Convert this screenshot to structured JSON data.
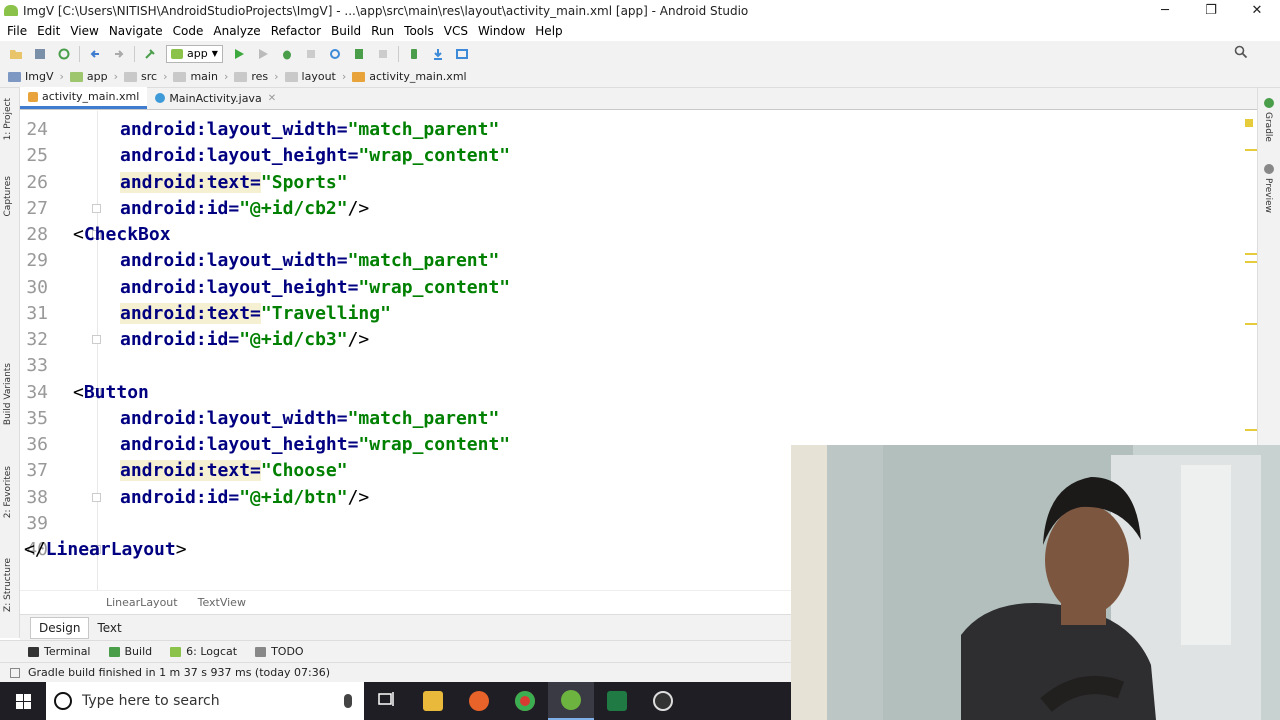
{
  "window": {
    "title": "ImgV [C:\\Users\\NITISH\\AndroidStudioProjects\\ImgV] - ...\\app\\src\\main\\res\\layout\\activity_main.xml [app] - Android Studio",
    "minimize": "─",
    "maximize": "❐",
    "close": "✕"
  },
  "menu": [
    "File",
    "Edit",
    "View",
    "Navigate",
    "Code",
    "Analyze",
    "Refactor",
    "Build",
    "Run",
    "Tools",
    "VCS",
    "Window",
    "Help"
  ],
  "toolbar": {
    "run_config": "app"
  },
  "breadcrumbs": [
    "ImgV",
    "app",
    "src",
    "main",
    "res",
    "layout",
    "activity_main.xml"
  ],
  "tabs": [
    {
      "label": "activity_main.xml",
      "active": true
    },
    {
      "label": "MainActivity.java",
      "active": false
    }
  ],
  "left_tool_windows": [
    "1: Project",
    "Captures",
    "Build Variants",
    "2: Favorites",
    "Z: Structure"
  ],
  "right_tool_windows": [
    "Gradle",
    "Preview"
  ],
  "code_lines": [
    {
      "n": "24",
      "parts": [
        [
          "attr",
          "android:layout_width="
        ],
        [
          "val",
          "\"match_parent\""
        ]
      ]
    },
    {
      "n": "25",
      "parts": [
        [
          "attr",
          "android:layout_height="
        ],
        [
          "val",
          "\"wrap_content\""
        ]
      ]
    },
    {
      "n": "26",
      "parts": [
        [
          "attr",
          "android:text="
        ],
        [
          "val",
          "\"Sports\""
        ]
      ],
      "hl": true
    },
    {
      "n": "27",
      "parts": [
        [
          "attr",
          "android:id="
        ],
        [
          "val",
          "\"@+id/cb2\""
        ],
        [
          "punct",
          "/>"
        ]
      ]
    },
    {
      "n": "28",
      "parts": [
        [
          "punct",
          "<"
        ],
        [
          "tag",
          "CheckBox"
        ]
      ],
      "indent": "tag"
    },
    {
      "n": "29",
      "parts": [
        [
          "attr",
          "android:layout_width="
        ],
        [
          "val",
          "\"match_parent\""
        ]
      ]
    },
    {
      "n": "30",
      "parts": [
        [
          "attr",
          "android:layout_height="
        ],
        [
          "val",
          "\"wrap_content\""
        ]
      ]
    },
    {
      "n": "31",
      "parts": [
        [
          "attr",
          "android:text="
        ],
        [
          "val",
          "\"Travelling\""
        ]
      ],
      "hl": true
    },
    {
      "n": "32",
      "parts": [
        [
          "attr",
          "android:id="
        ],
        [
          "val",
          "\"@+id/cb3\""
        ],
        [
          "punct",
          "/>"
        ]
      ]
    },
    {
      "n": "33",
      "parts": []
    },
    {
      "n": "34",
      "parts": [
        [
          "punct",
          "<"
        ],
        [
          "tag",
          "Button"
        ]
      ],
      "indent": "tag"
    },
    {
      "n": "35",
      "parts": [
        [
          "attr",
          "android:layout_width="
        ],
        [
          "val",
          "\"match_parent\""
        ]
      ]
    },
    {
      "n": "36",
      "parts": [
        [
          "attr",
          "android:layout_height="
        ],
        [
          "val",
          "\"wrap_content\""
        ]
      ]
    },
    {
      "n": "37",
      "parts": [
        [
          "attr",
          "android:text="
        ],
        [
          "val",
          "\"Choose\""
        ]
      ],
      "hl": true
    },
    {
      "n": "38",
      "parts": [
        [
          "attr",
          "android:id="
        ],
        [
          "val",
          "\"@+id/btn\""
        ],
        [
          "punct",
          "/>"
        ]
      ]
    },
    {
      "n": "39",
      "parts": []
    },
    {
      "n": "40",
      "parts": [
        [
          "punct",
          "</"
        ],
        [
          "tag",
          "LinearLayout"
        ],
        [
          "punct",
          ">"
        ]
      ],
      "indent": "root"
    }
  ],
  "editor_breadcrumb": [
    "LinearLayout",
    "TextView"
  ],
  "editor_mode_tabs": [
    "Design",
    "Text"
  ],
  "active_mode": "Text",
  "tool_windows": [
    "Terminal",
    "Build",
    "6: Logcat",
    "TODO"
  ],
  "status_text": "Gradle build finished in 1 m 37 s 937 ms (today 07:36)",
  "taskbar": {
    "search_placeholder": "Type here to search",
    "apps": [
      "task-view",
      "file-explorer",
      "firefox",
      "chrome",
      "android-studio",
      "excel",
      "obs"
    ]
  },
  "colors": {
    "attr": "#000080",
    "value": "#008000",
    "highlight": "#f5f0d2",
    "taskbar": "#1e1e24"
  }
}
